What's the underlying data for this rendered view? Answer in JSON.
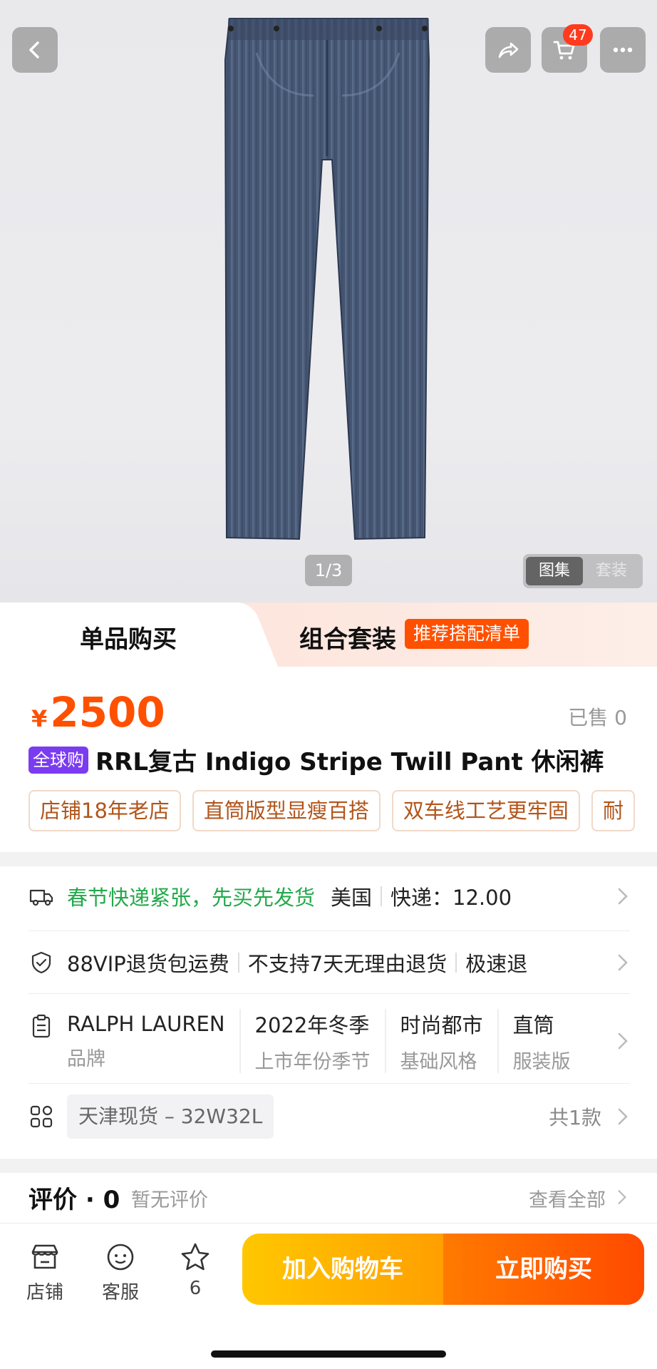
{
  "header": {
    "cart_count": "47",
    "icons": [
      "back-arrow-icon",
      "share-icon",
      "cart-icon",
      "more-icon"
    ]
  },
  "gallery": {
    "page_indicator": "1/3",
    "tabs": [
      "图集",
      "套装"
    ],
    "active_tab": "图集"
  },
  "purchase_tabs": {
    "single": "单品购买",
    "combo": "组合套装",
    "combo_badge": "推荐搭配清单"
  },
  "product": {
    "price_symbol": "¥",
    "price": "2500",
    "sold": "已售 0",
    "badge": "全球购",
    "title": "RRL复古 Indigo Stripe Twill Pant 休闲裤",
    "tags": [
      "店铺18年老店",
      "直筒版型显瘦百搭",
      "双车线工艺更牢固",
      "耐"
    ]
  },
  "service": {
    "shipping_notice": "春节快递紧张，先买先发货",
    "origin": "美国",
    "shipping_fee": "快递：12.00",
    "return_vip": "88VIP退货包运费",
    "return_policy": "不支持7天无理由退货",
    "return_fast": "极速退"
  },
  "params": [
    {
      "value": "RALPH LAUREN",
      "key": "品牌"
    },
    {
      "value": "2022年冬季",
      "key": "上市年份季节"
    },
    {
      "value": "时尚都市",
      "key": "基础风格"
    },
    {
      "value": "直筒",
      "key": "服装版"
    }
  ],
  "sku": {
    "selected": "天津现货 – 32W32L",
    "count": "共1款"
  },
  "reviews": {
    "title": "评价 · 0",
    "empty": "暂无评价",
    "view_all": "查看全部"
  },
  "bottom_bar": {
    "store": "店铺",
    "service": "客服",
    "favorites": "6",
    "add_to_cart": "加入购物车",
    "buy_now": "立即购买"
  },
  "colors": {
    "accent": "#ff5000",
    "price": "#ff5000",
    "global_badge": "#7b3bf0",
    "shipping_notice": "#23a94b",
    "cart_button": "#ffb300",
    "buy_button": "#ff5a00"
  }
}
